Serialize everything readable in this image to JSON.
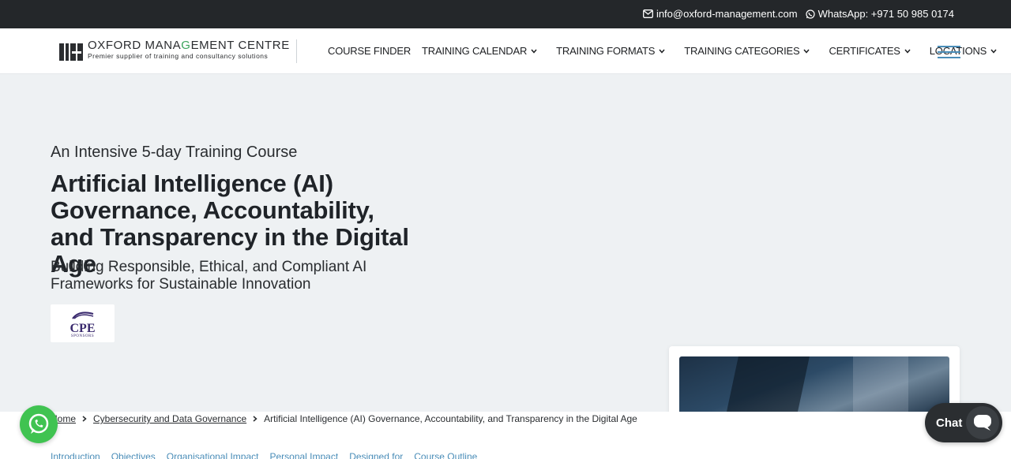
{
  "topbar": {
    "email": "info@oxford-management.com",
    "whatsapp": "WhatsApp: +971 50 985 0174",
    "email_icon": "envelope-icon",
    "whatsapp_icon": "whatsapp-icon"
  },
  "logo": {
    "name_a": "OXFORD MANA",
    "name_g": "G",
    "name_b": "EMENT CENTRE",
    "tagline": "Premier supplier of training and consultancy solutions"
  },
  "menu": {
    "items": [
      {
        "label": "COURSE FINDER",
        "has_dropdown": false
      },
      {
        "label": "TRAINING CALENDAR",
        "has_dropdown": true
      },
      {
        "label": "TRAINING FORMATS",
        "has_dropdown": true
      },
      {
        "label": "TRAINING CATEGORIES",
        "has_dropdown": true
      },
      {
        "label": "CERTIFICATES",
        "has_dropdown": true
      },
      {
        "label": "LOCATIONS",
        "has_dropdown": true
      }
    ],
    "burger_icon": "hamburger-menu-icon"
  },
  "hero": {
    "pretitle": "An Intensive 5-day Training Course",
    "title": "Artificial Intelligence (AI) Governance, Accountability, and Transparency in the Digital Age",
    "subtitle": "Building Responsible, Ethical, and Compliant AI Frameworks for Sustainable Innovation",
    "badge_text": "CPE",
    "badge_sub": "SPONSORS"
  },
  "breadcrumb": {
    "home": "Home",
    "category": "Cybersecurity and Data Governance",
    "current": "Artificial Intelligence (AI) Governance, Accountability, and Transparency in the Digital Age"
  },
  "tabs": [
    "Introduction",
    "Objectives",
    "Organisational Impact",
    "Personal Impact",
    "Designed for",
    "Course Outline"
  ],
  "chat": {
    "label": "Chat"
  },
  "colors": {
    "topbar_bg": "#24272a",
    "hero_bg": "#eef1f3",
    "accent": "#4a8db8",
    "whatsapp_green": "#40c351",
    "chat_bg": "#2b2e31"
  }
}
